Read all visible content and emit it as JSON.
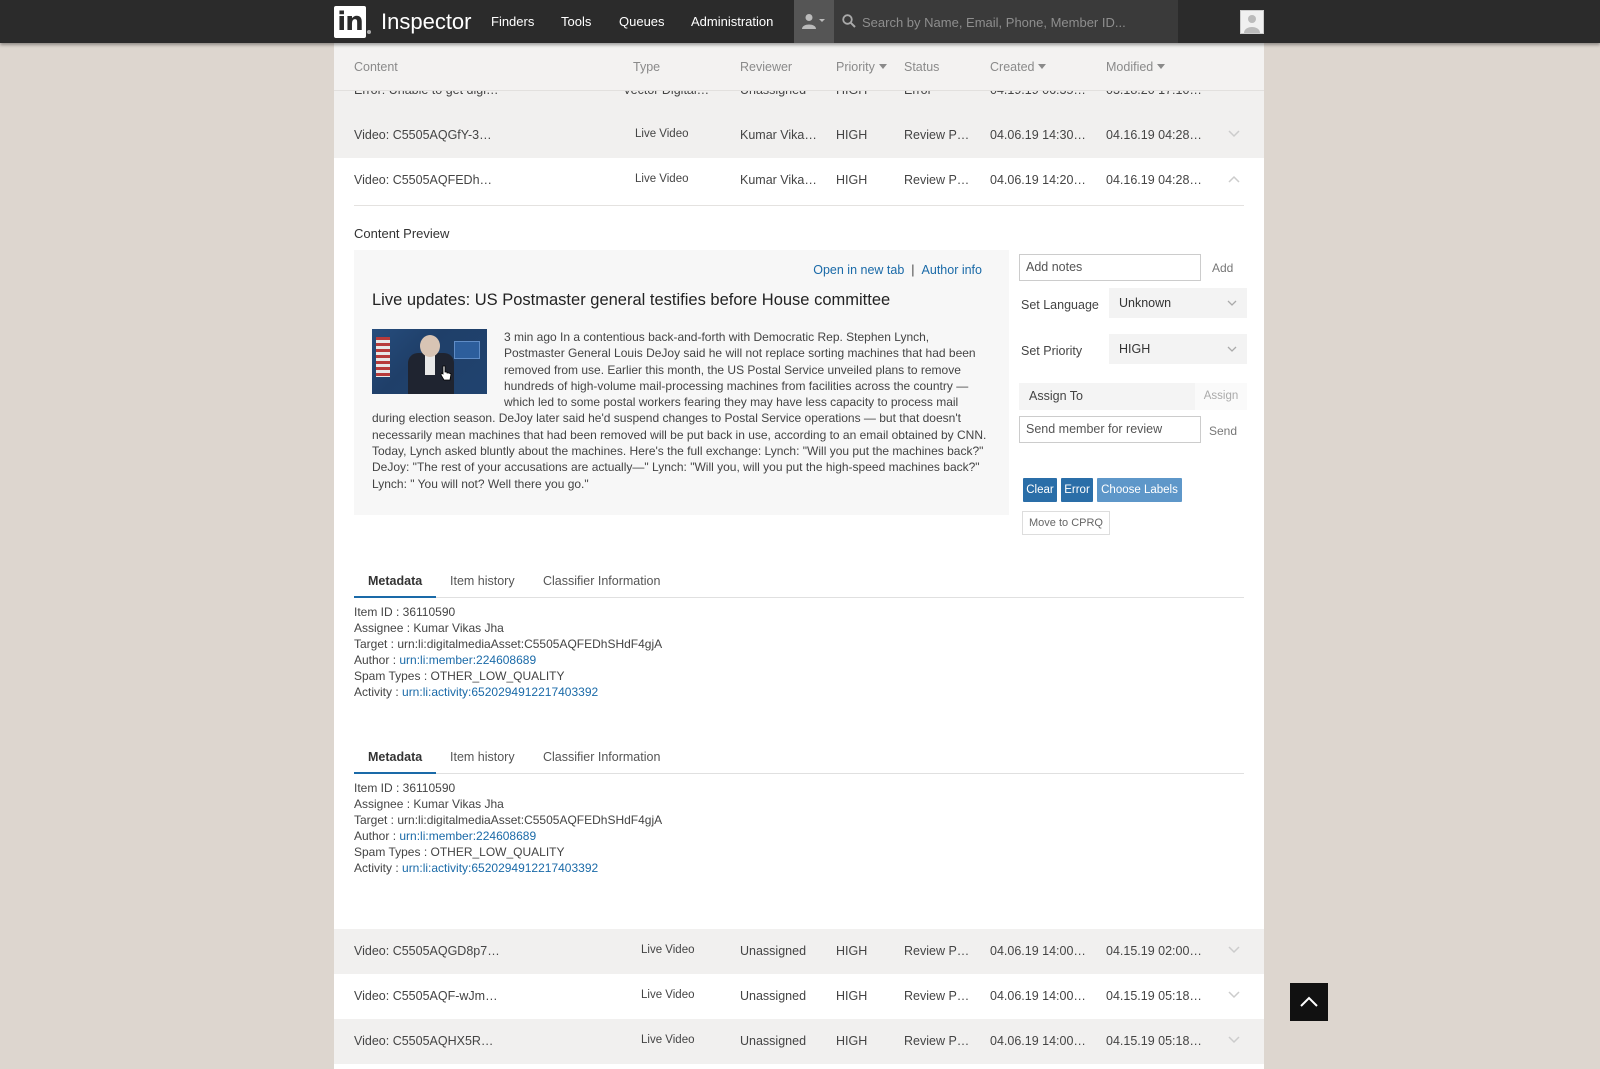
{
  "header": {
    "app_title": "Inspector",
    "logo_text": "in",
    "nav": [
      "Finders",
      "Tools",
      "Queues",
      "Administration"
    ],
    "search_placeholder": "Search by Name, Email, Phone, Member ID..."
  },
  "table": {
    "columns": {
      "content": "Content",
      "type": "Type",
      "reviewer": "Reviewer",
      "priority": "Priority",
      "status": "Status",
      "created": "Created",
      "modified": "Modified"
    },
    "partial_row": {
      "content": "Error: Unable to get digi…",
      "type": "Vector Digital…",
      "reviewer": "Unassigned",
      "priority": "HIGH",
      "status": "Error",
      "created": "04.19.19 06:35…",
      "modified": "03.18.20 17:10…"
    },
    "rows": [
      {
        "content": "Video: C5505AQGfY-3…",
        "type": "Live Video",
        "reviewer": "Kumar Vika…",
        "priority": "HIGH",
        "status": "Review P…",
        "created": "04.06.19 14:30…",
        "modified": "04.16.19 04:28…"
      },
      {
        "content": "Video: C5505AQFEDh…",
        "type": "Live Video",
        "reviewer": "Kumar Vika…",
        "priority": "HIGH",
        "status": "Review P…",
        "created": "04.06.19 14:20…",
        "modified": "04.16.19 04:28…"
      }
    ],
    "bottom_rows": [
      {
        "content": "Video: C5505AQGD8p7…",
        "type": "Live Video",
        "reviewer": "Unassigned",
        "priority": "HIGH",
        "status": "Review P…",
        "created": "04.06.19 14:00…",
        "modified": "04.15.19 02:00…"
      },
      {
        "content": "Video: C5505AQF-wJm…",
        "type": "Live Video",
        "reviewer": "Unassigned",
        "priority": "HIGH",
        "status": "Review P…",
        "created": "04.06.19 14:00…",
        "modified": "04.15.19 05:18…"
      },
      {
        "content": "Video: C5505AQHX5R…",
        "type": "Live Video",
        "reviewer": "Unassigned",
        "priority": "HIGH",
        "status": "Review P…",
        "created": "04.06.19 14:00…",
        "modified": "04.15.19 05:18…"
      }
    ]
  },
  "detail": {
    "section_title": "Content Preview",
    "open_new_tab": "Open in new tab",
    "separator": "|",
    "author_info": "Author info",
    "preview_title": "Live updates: US Postmaster general testifies before House committee",
    "preview_text": "3 min ago In a contentious back-and-forth with Democratic Rep. Stephen Lynch, Postmaster General Louis DeJoy said he will not replace sorting machines that had been removed from use. Earlier this month, the  US Postal Service  unveiled plans to remove hundreds of high-volume mail-processing machines from facilities across the country — which led to some postal workers fearing they may have less capacity to process mail during election season. DeJoy later said he'd suspend changes to Postal Service operations — but that doesn't necessarily mean machines that had been removed will be put back in use, according to an email obtained by CNN. Today, Lynch asked bluntly about the machines. Here's the full exchange: Lynch: \"Will you put the machines back?\" DeJoy: \"The rest of your accusations are actually—\" Lynch: \"Will you, will you put the high-speed machines back?\" Lynch: \" You will not? Well there you go.\"",
    "notes_placeholder": "Add notes",
    "add_label": "Add",
    "language_label": "Set Language",
    "language_value": "Unknown",
    "priority_label": "Set Priority",
    "priority_value": "HIGH",
    "assign_label": "Assign To",
    "assign_button": "Assign",
    "send_placeholder": "Send member for review",
    "send_label": "Send",
    "clear_label": "Clear",
    "error_label": "Error",
    "choose_labels": "Choose Labels",
    "move_label": "Move to CPRQ"
  },
  "tabs": [
    "Metadata",
    "Item history",
    "Classifier Information"
  ],
  "metadata": {
    "item_id": "Item ID : 36110590",
    "assignee": "Assignee : Kumar Vikas Jha",
    "target": "Target : urn:li:digitalmediaAsset:C5505AQFEDhSHdF4gjA",
    "author_label": "Author : ",
    "author_link": "urn:li:member:224608689",
    "spam_types": "Spam Types : OTHER_LOW_QUALITY",
    "activity_label": "Activity : ",
    "activity_link": "urn:li:activity:6520294912217403392"
  },
  "colors": {
    "topbar": "#2b2b2b",
    "accent_blue": "#1a6aa8",
    "button_dark_blue": "#2a6ea8",
    "button_light_blue": "#5e97c9",
    "page_bg": "#ddd6cf"
  },
  "icons": [
    "user-icon",
    "search-icon",
    "avatar-icon",
    "chevron-down-icon",
    "chevron-up-icon",
    "arrow-up-icon"
  ]
}
